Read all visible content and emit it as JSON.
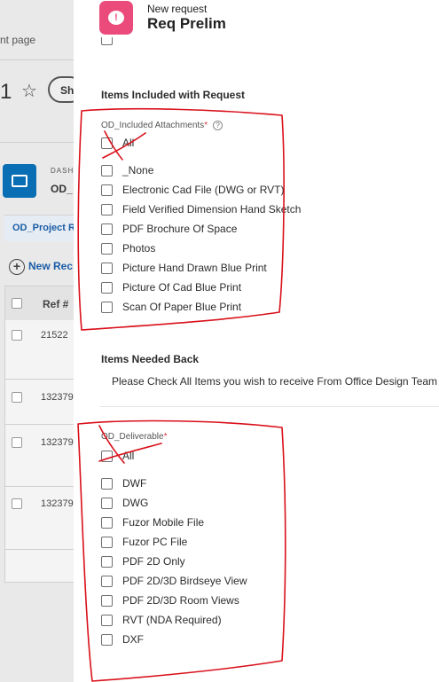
{
  "background": {
    "breadcrumb_fragment": "nt page",
    "record_number_fragment": "1",
    "button_fragment": "Sh",
    "dashboard_label": "DASH",
    "dashboard_name_fragment": "OD_",
    "tab_label_fragment": "OD_Project R",
    "new_record_label": "New Rec",
    "table_header_ref": "Ref #",
    "table_rows": [
      "21522",
      "132379",
      "132379",
      "132379"
    ]
  },
  "modal": {
    "subtitle": "New request",
    "title": "Req Prelim",
    "section_included": "Items Included with Request",
    "attachments_field": {
      "label": "OD_Included Attachments",
      "required_mark": "*",
      "help_glyph": "?",
      "options": [
        "All",
        "_None",
        "Electronic Cad File (DWG or RVT)",
        "Field Verified Dimension Hand Sketch",
        "PDF Brochure Of Space",
        "Photos",
        "Picture Hand Drawn Blue Print",
        "Picture Of Cad Blue Print",
        "Scan Of Paper Blue Print"
      ]
    },
    "section_needed_back": "Items Needed Back",
    "needed_back_description": "Please Check All Items you wish to receive From Office Design Team",
    "deliverable_field": {
      "label": "OD_Deliverable",
      "required_mark": "*",
      "options": [
        "All",
        "DWF",
        "DWG",
        "Fuzor Mobile File",
        "Fuzor PC File",
        "PDF 2D Only",
        "PDF 2D/3D Birdseye View",
        "PDF 2D/3D Room Views",
        "RVT (NDA Required)",
        "DXF"
      ]
    }
  },
  "colors": {
    "app_icon": "#ea4b7a",
    "required_asterisk": "#d7373f",
    "annotation_ink": "#d9101a",
    "background_link": "#1a5da6"
  },
  "icons": {
    "app": "chat-alert-icon",
    "help": "help-circle-icon",
    "favorite": "star-icon",
    "dashboard": "dashboard-icon",
    "add": "plus-circle-icon"
  }
}
